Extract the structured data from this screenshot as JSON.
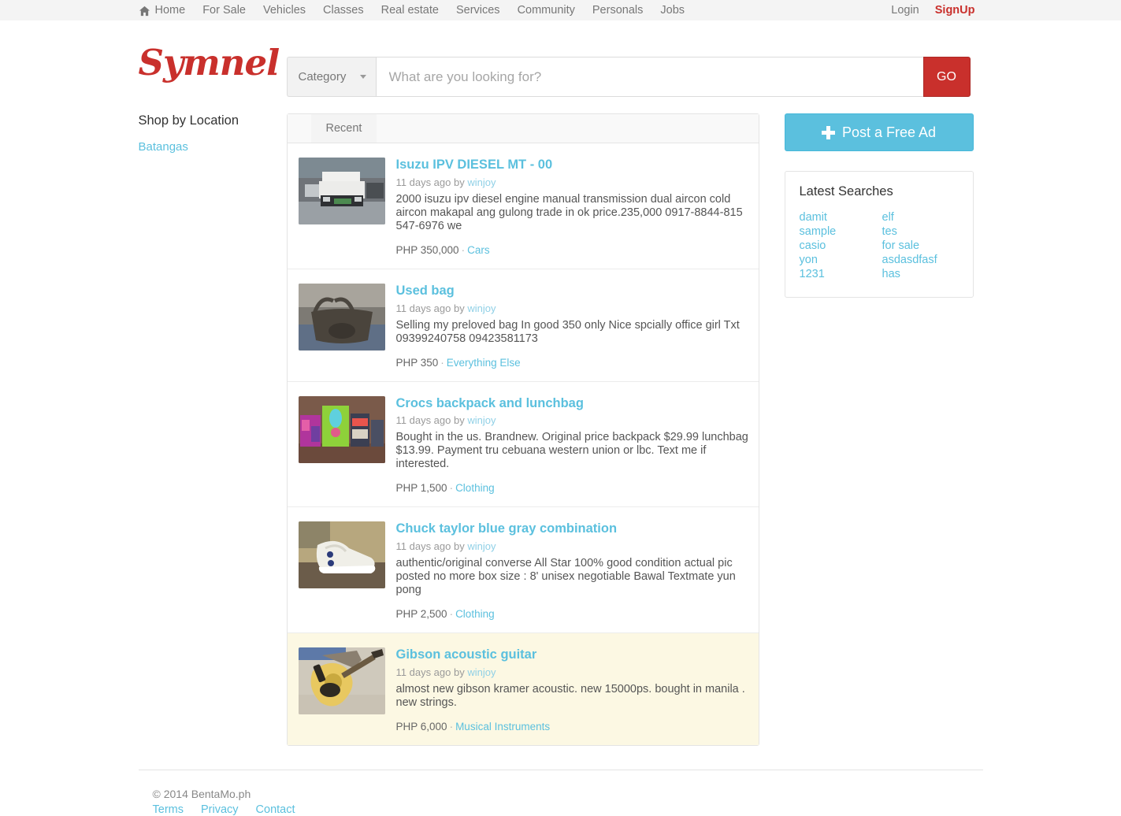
{
  "navbar": {
    "home_label": "Home",
    "items": [
      "For Sale",
      "Vehicles",
      "Classes",
      "Real estate",
      "Services",
      "Community",
      "Personals",
      "Jobs"
    ],
    "login_label": "Login",
    "signup_label": "SignUp",
    "home_icon": "home-icon",
    "background": "#f4f4f4"
  },
  "brand": {
    "name": "Symnel",
    "color": "#c9302c"
  },
  "search": {
    "category_label": "Category",
    "caret_icon": "chevron-down-icon",
    "placeholder": "What are you looking for?",
    "value": "",
    "go_label": "GO",
    "go_color": "#c9302c"
  },
  "sidebar_left": {
    "title": "Shop by Location",
    "locations": [
      "Batangas"
    ]
  },
  "listings_panel": {
    "tabs": [
      {
        "label": "Recent",
        "active": true
      }
    ],
    "items": [
      {
        "title": "Isuzu IPV DIESEL MT - 00",
        "meta": "11 days ago by ",
        "author": "winjoy",
        "description": "2000 isuzu ipv diesel engine manual transmission dual aircon cold aircon makapal ang gulong trade in ok price.235,000 0917-8844-815 547-6976 we",
        "price": "PHP 350,000",
        "separator": "·",
        "category": "Cars",
        "thumb": "pickup-truck-photo",
        "highlight": false
      },
      {
        "title": "Used bag",
        "meta": "11 days ago by ",
        "author": "winjoy",
        "description": "Selling my preloved bag In good 350 only Nice spcially office girl Txt 09399240758 09423581173",
        "price": "PHP 350",
        "separator": "·",
        "category": "Everything Else",
        "thumb": "handbag-photo",
        "highlight": false
      },
      {
        "title": "Crocs backpack and lunchbag",
        "meta": "11 days ago by ",
        "author": "winjoy",
        "description": "Bought in the us. Brandnew. Original price backpack $29.99 lunchbag $13.99. Payment tru cebuana western union or lbc. Text me if interested.",
        "price": "PHP 1,500",
        "separator": "·",
        "category": "Clothing",
        "thumb": "backpack-photo",
        "highlight": false
      },
      {
        "title": "Chuck taylor blue gray combination",
        "meta": "11 days ago by ",
        "author": "winjoy",
        "description": "authentic/original converse All Star 100% good condition actual pic posted no more box size : 8' unisex negotiable Bawal Textmate yun pong",
        "price": "PHP 2,500",
        "separator": "·",
        "category": "Clothing",
        "thumb": "sneaker-photo",
        "highlight": false
      },
      {
        "title": "Gibson acoustic guitar",
        "meta": "11 days ago by ",
        "author": "winjoy",
        "description": "almost new gibson kramer acoustic. new 15000ps. bought in manila . new strings.",
        "price": "PHP 6,000",
        "separator": "·",
        "category": "Musical Instruments",
        "thumb": "guitar-photo",
        "highlight": true
      }
    ]
  },
  "sidebar_right": {
    "post_ad_label": "Post a Free Ad",
    "post_ad_icon": "plus-icon",
    "post_ad_color": "#5bc0de",
    "latest_searches_title": "Latest Searches",
    "latest_searches": [
      "damit",
      "elf",
      "sample",
      "tes",
      "casio",
      "for sale",
      "yon",
      "asdasdfasf",
      "1231",
      "has"
    ]
  },
  "footer": {
    "copyright": "© 2014 BentaMo.ph",
    "links": [
      "Terms",
      "Privacy",
      "Contact"
    ]
  }
}
